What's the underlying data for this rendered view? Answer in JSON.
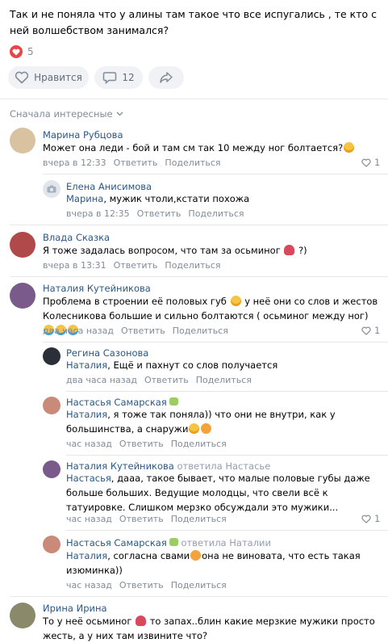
{
  "post": {
    "text": "Так и не поняла что у алины там такое что все испугались , те кто с ней волшебством занимался?",
    "like_count": "5",
    "like_button": "Нравится",
    "comment_count": "12"
  },
  "sort_label": "Сначала интересные",
  "comments": [
    {
      "name": "Марина Рубцова",
      "text": "Может она леди - бой и там см так 10 между ног болтается?",
      "time": "вчера в 12:33",
      "reply": "Ответить",
      "share": "Поделиться",
      "likes": "1",
      "avatar_color": "#d8c2a0"
    },
    {
      "name": "Елена Анисимова",
      "addr": "Марина",
      "text": ", мужик чтоли,кстати похожа",
      "time": "вчера в 12:35",
      "reply": "Ответить",
      "share": "Поделиться"
    },
    {
      "name": "Влада Сказка",
      "text": "Я тоже задалась вопросом, что там за осьминог",
      "text_tail": "?)",
      "time": "вчера в 13:31",
      "reply": "Ответить",
      "share": "Поделиться",
      "avatar_color": "#b04a4a"
    },
    {
      "name": "Наталия Кутейникова",
      "text": "Проблема в строении её половых губ",
      "text2": "у неё они со слов и жестов Колесникова большие и сильно болтаются ( осьминог между ног)",
      "time": "два часа назад",
      "reply": "Ответить",
      "share": "Поделиться",
      "likes": "1",
      "avatar_color": "#7a5a8a"
    },
    {
      "name": "Регина Сазонова",
      "addr": "Наталия",
      "text": ", Ещё и пахнут со слов получается",
      "time": "два часа назад",
      "reply": "Ответить",
      "share": "Поделиться",
      "avatar_color": "#2b2f38"
    },
    {
      "name": "Настасья Самарская",
      "addr": "Наталия",
      "text": ", я тоже так поняла)) что они не внутри, как у большинства, а снаружи",
      "time": "час назад",
      "reply": "Ответить",
      "share": "Поделиться",
      "avatar_color": "#c98a7a"
    },
    {
      "name": "Наталия Кутейникова",
      "replied": "ответила Настасье",
      "addr": "Настасья",
      "text": ", дааа, такое бывает, что малые половые губы даже больше больших. Ведущие молодцы, что свели всё к татуировке. Слишком мерзко обсуждали это мужики...",
      "time": "час назад",
      "reply": "Ответить",
      "share": "Поделиться",
      "likes": "1",
      "avatar_color": "#7a5a8a"
    },
    {
      "name": "Настасья Самарская",
      "replied": "ответила Наталии",
      "addr": "Наталия",
      "text": ", согласна свами",
      "text2": "она не виновата, что есть такая изюминка))",
      "time": "час назад",
      "reply": "Ответить",
      "share": "Поделиться",
      "avatar_color": "#c98a7a"
    },
    {
      "name": "Ирина Ирина",
      "text": "То у неё осьминог",
      "text2": "то запах..блин какие мерзкие мужики просто жесть, а у них там извините что?",
      "avatar_color": "#8a8a6a"
    }
  ]
}
